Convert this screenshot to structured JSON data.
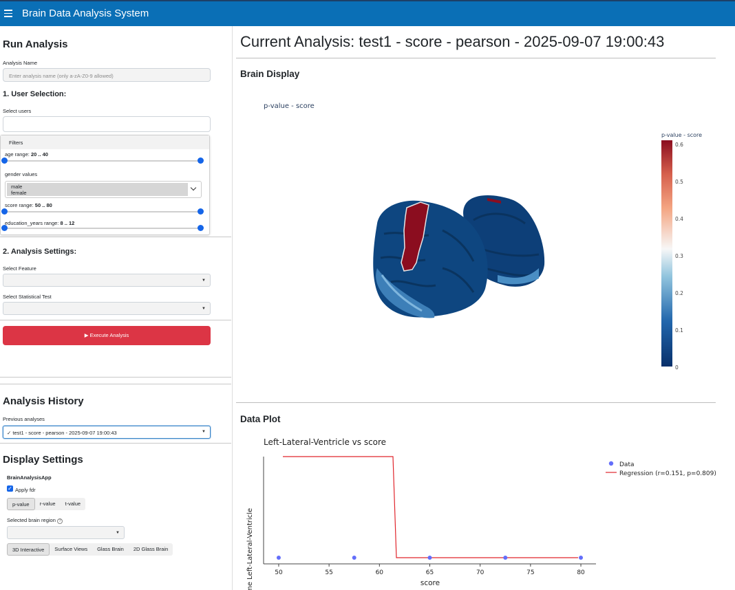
{
  "app": {
    "title": "Brain Data Analysis System"
  },
  "run_analysis": {
    "heading": "Run Analysis",
    "name_label": "Analysis Name",
    "name_placeholder": "Enter analysis name (only a-zA-Z0-9 allowed)",
    "user_selection_heading": "1. User Selection:",
    "select_users_label": "Select users",
    "filters": {
      "title": "Filters",
      "age_label": "age range: ",
      "age_value": "20 .. 40",
      "gender_label": "gender values",
      "gender_options": [
        "male",
        "female"
      ],
      "score_label": "score range: ",
      "score_value": "50 .. 80",
      "education_label": "education_years range: ",
      "education_value": "8 .. 12"
    },
    "settings_heading": "2. Analysis Settings:",
    "feature_label": "Select Feature",
    "test_label": "Select Statistical Test",
    "execute_label": "▶ Execute Analysis"
  },
  "history": {
    "heading": "Analysis History",
    "previous_label": "Previous analyses",
    "selected": "✓ test1 - score - pearson - 2025-09-07 19:00:43"
  },
  "display_settings": {
    "heading": "Display Settings",
    "app_name": "BrainAnalysisApp",
    "apply_fdr_label": "Apply fdr",
    "apply_fdr_checked": true,
    "value_tabs": [
      "p-value",
      "r-value",
      "t-value"
    ],
    "value_tab_active": "p-value",
    "region_label": "Selected brain region",
    "view_tabs": [
      "3D Interactive",
      "Surface Views",
      "Glass Brain",
      "2D Glass Brain"
    ],
    "view_tab_active": "3D Interactive"
  },
  "main": {
    "title": "Current Analysis: test1 - score - pearson - 2025-09-07 19:00:43",
    "brain_display": {
      "heading": "Brain Display",
      "plot_title": "p-value - score",
      "colorbar_title": "p-value - score",
      "colorbar_ticks": [
        "0.6",
        "0.5",
        "0.4",
        "0.3",
        "0.2",
        "0.1",
        "0"
      ],
      "colors": {
        "low": "#08306b",
        "mid": "#f7f7f7",
        "high": "#8b0d1f"
      }
    },
    "data_plot": {
      "heading": "Data Plot"
    }
  },
  "chart_data": {
    "type": "scatter",
    "title": "Left-Lateral-Ventricle vs score",
    "xlabel": "score",
    "ylabel": "Volume Left-Lateral-Ventricle",
    "xlim": [
      48.5,
      81.5
    ],
    "xticks": [
      50,
      55,
      60,
      65,
      70,
      75,
      80
    ],
    "series": [
      {
        "name": "Data",
        "type": "scatter",
        "color": "#636efa",
        "x": [
          50,
          57.5,
          65,
          72.5,
          80
        ],
        "y": [
          0,
          0,
          0,
          0,
          0
        ]
      },
      {
        "name": "Regression (r=0.151, p=0.809)",
        "type": "line",
        "color": "#e0242b"
      }
    ],
    "legend": "top-right",
    "grid": false
  }
}
